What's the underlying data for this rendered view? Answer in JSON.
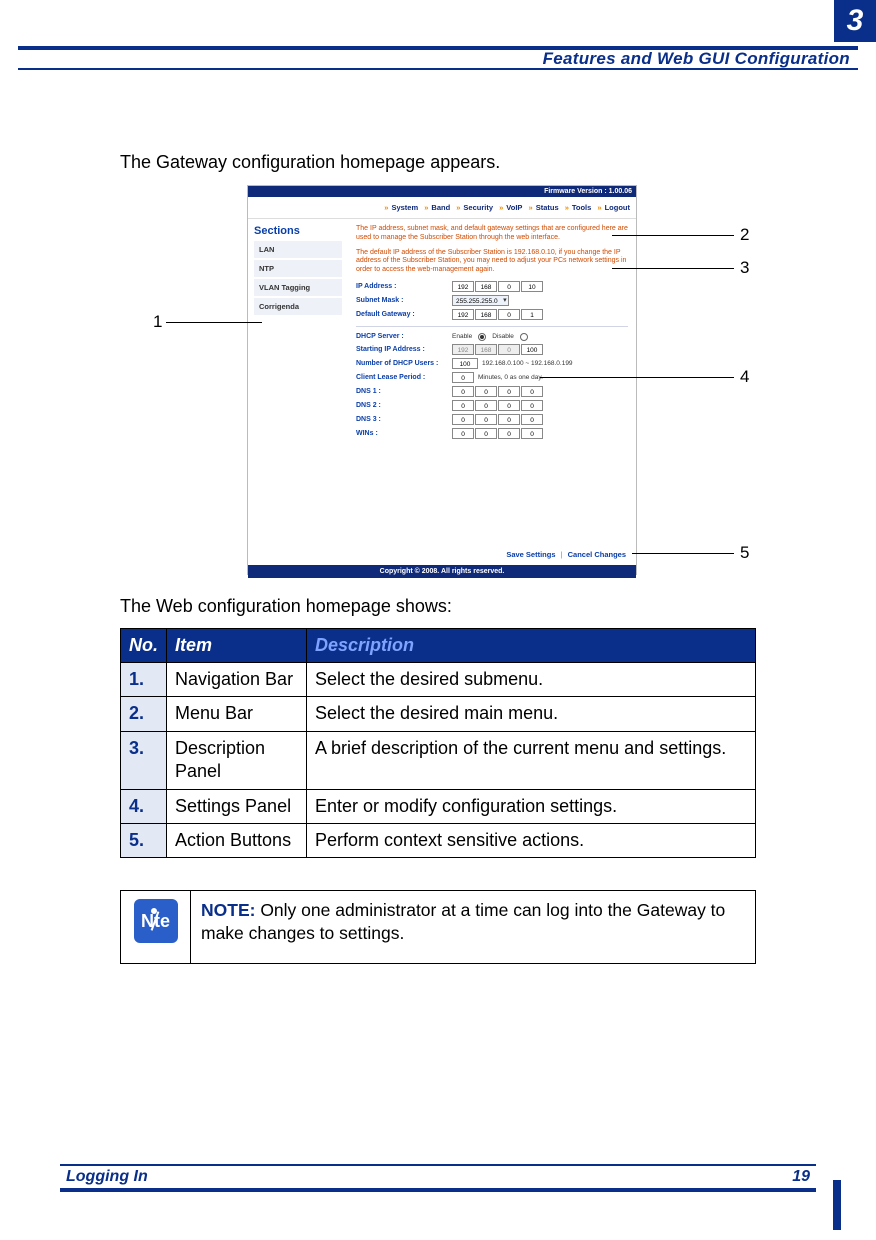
{
  "header": {
    "chapter_title": "Features and Web GUI Configuration",
    "chapter_number": "3"
  },
  "footer": {
    "section": "Logging In",
    "page": "19"
  },
  "intro": {
    "line1": "The Gateway configuration homepage appears.",
    "line2": "The Web configuration homepage shows:"
  },
  "callouts": [
    "1",
    "2",
    "3",
    "4",
    "5"
  ],
  "shot": {
    "firmware": "Firmware Version : 1.00.06",
    "menu": [
      "System",
      "Band",
      "Security",
      "VoIP",
      "Status",
      "Tools",
      "Logout"
    ],
    "sidebar_title": "Sections",
    "sidebar": [
      "LAN",
      "NTP",
      "VLAN Tagging",
      "Corrigenda"
    ],
    "desc1": "The IP address, subnet mask, and default gateway settings that are configured here are used to manage the Subscriber Station through the web interface.",
    "desc2": "The default IP address of the Subscriber Station is 192.168.0.10, if you change the IP address of the Subscriber Station, you may need to adjust your PCs network settings in order to access the web-management again.",
    "labels": {
      "ip": "IP Address :",
      "subnet": "Subnet Mask :",
      "gw": "Default Gateway :",
      "dhcp": "DHCP Server :",
      "start_ip": "Starting IP Address :",
      "num_users": "Number of DHCP Users :",
      "lease": "Client Lease Period :",
      "dns1": "DNS 1 :",
      "dns2": "DNS 2 :",
      "dns3": "DNS 3 :",
      "wins": "WINs :"
    },
    "values": {
      "ip": [
        "192",
        "168",
        "0",
        "10"
      ],
      "subnet": "255.255.255.0",
      "gw": [
        "192",
        "168",
        "0",
        "1"
      ],
      "enable": "Enable",
      "disable": "Disable",
      "start_ip": [
        "192",
        "168",
        "0",
        "100"
      ],
      "num_users": "100",
      "range": "192.168.0.100 ~ 192.168.0.199",
      "lease": "0",
      "lease_hint": "Minutes, 0 as one day.",
      "dns1": [
        "0",
        "0",
        "0",
        "0"
      ],
      "dns2": [
        "0",
        "0",
        "0",
        "0"
      ],
      "dns3": [
        "0",
        "0",
        "0",
        "0"
      ],
      "wins": [
        "0",
        "0",
        "0",
        "0"
      ]
    },
    "actions": {
      "save": "Save Settings",
      "cancel": "Cancel Changes"
    },
    "copyright": "Copyright © 2008.  All rights reserved."
  },
  "table": {
    "head": [
      "No.",
      "Item",
      "Description"
    ],
    "rows": [
      {
        "no": "1.",
        "item": "Navigation Bar",
        "desc": "Select the desired submenu."
      },
      {
        "no": "2.",
        "item": "Menu Bar",
        "desc": "Select the desired main menu."
      },
      {
        "no": "3.",
        "item": "Description Panel",
        "desc": "A brief description of the current menu and settings."
      },
      {
        "no": "4.",
        "item": "Settings Panel",
        "desc": "Enter or modify configuration settings."
      },
      {
        "no": "5.",
        "item": "Action Buttons",
        "desc": "Perform context sensitive actions."
      }
    ]
  },
  "note": {
    "lead": "NOTE:",
    "icon_left": "N",
    "icon_right": "te",
    "text": " Only one administrator at a time can log into the Gateway to make changes to settings."
  }
}
